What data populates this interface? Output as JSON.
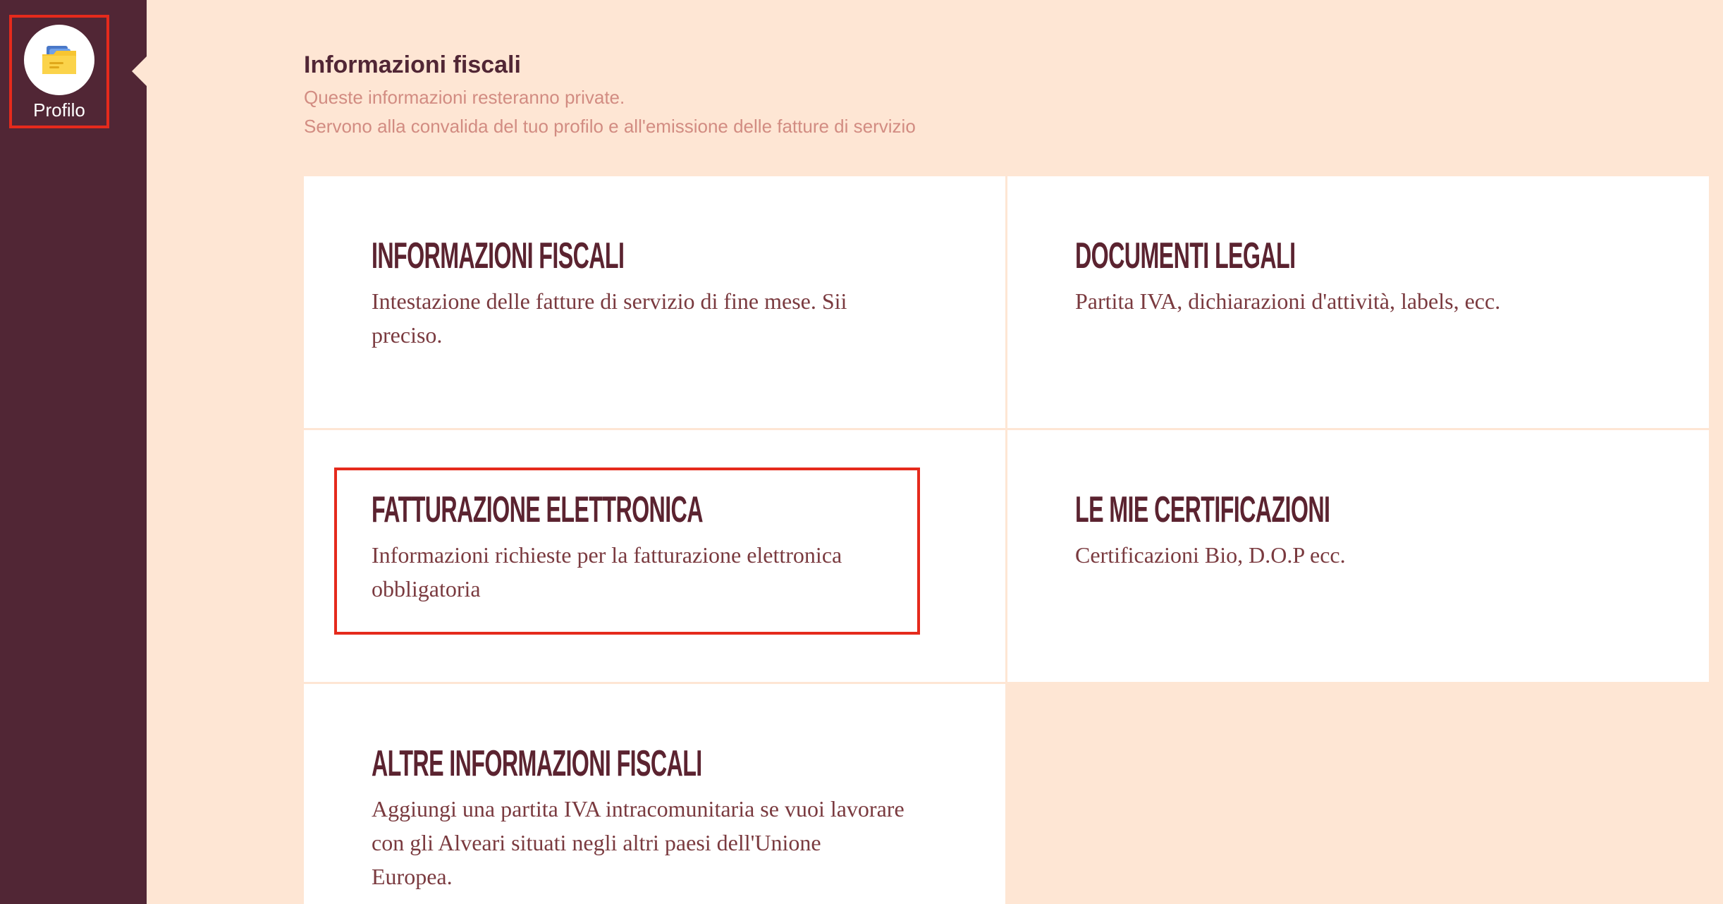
{
  "sidebar": {
    "profile_label": "Profilo",
    "profile_icon": "folder-icon",
    "background": "#512635",
    "highlight_color": "#e52a1c"
  },
  "header": {
    "title": "Informazioni fiscali",
    "subtitle_line1": "Queste informazioni resteranno private.",
    "subtitle_line2": "Servono alla convalida del tuo profilo e all'emissione delle fatture di servizio"
  },
  "cards": [
    {
      "title": "INFORMAZIONI FISCALI",
      "description": "Intestazione delle fatture di servizio di fine mese. Sii preciso."
    },
    {
      "title": "DOCUMENTI LEGALI",
      "description": "Partita IVA, dichiarazioni d'attività, labels, ecc."
    },
    {
      "title": "FATTURAZIONE ELETTRONICA",
      "description": "Informazioni richieste per la fatturazione elettronica obbligatoria"
    },
    {
      "title": "LE MIE CERTIFICAZIONI",
      "description": "Certificazioni Bio, D.O.P ecc."
    },
    {
      "title": "ALTRE INFORMAZIONI FISCALI",
      "description": "Aggiungi una partita IVA intracomunitaria se vuoi lavorare con gli Alveari situati negli altri paesi dell'Unione Europea."
    }
  ],
  "colors": {
    "page_background": "#fee6d4",
    "card_background": "#ffffff",
    "title_color": "#5b2330",
    "subtitle_color": "#d28c82"
  }
}
